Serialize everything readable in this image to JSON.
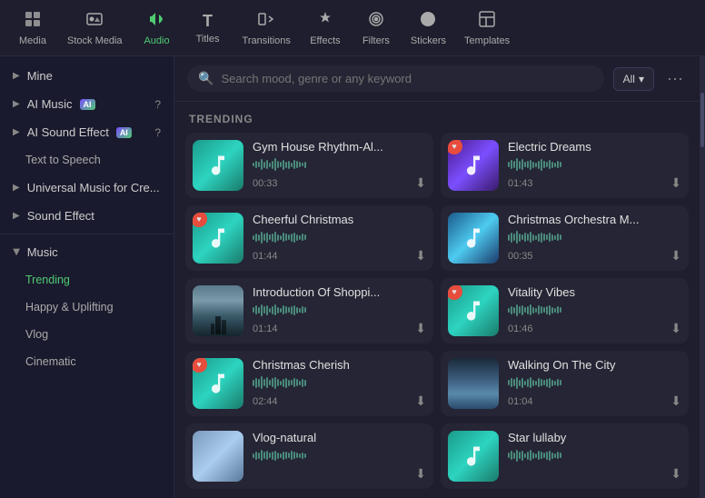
{
  "nav": {
    "items": [
      {
        "id": "media",
        "label": "Media",
        "icon": "⬜",
        "active": false
      },
      {
        "id": "stock-media",
        "label": "Stock Media",
        "icon": "📷",
        "active": false
      },
      {
        "id": "audio",
        "label": "Audio",
        "icon": "♪",
        "active": true
      },
      {
        "id": "titles",
        "label": "Titles",
        "icon": "T",
        "active": false
      },
      {
        "id": "transitions",
        "label": "Transitions",
        "icon": "▷",
        "active": false
      },
      {
        "id": "effects",
        "label": "Effects",
        "icon": "✦",
        "active": false
      },
      {
        "id": "filters",
        "label": "Filters",
        "icon": "◎",
        "active": false
      },
      {
        "id": "stickers",
        "label": "Stickers",
        "icon": "✿",
        "active": false
      },
      {
        "id": "templates",
        "label": "Templates",
        "icon": "⊟",
        "active": false
      }
    ]
  },
  "sidebar": {
    "items": [
      {
        "id": "mine",
        "label": "Mine",
        "type": "parent",
        "expanded": false
      },
      {
        "id": "ai-music",
        "label": "AI Music",
        "type": "parent",
        "badge": "AI",
        "has_help": true,
        "expanded": false
      },
      {
        "id": "ai-sound-effect",
        "label": "AI Sound Effect",
        "type": "parent",
        "badge": "AI",
        "has_help": true,
        "expanded": false
      },
      {
        "id": "text-to-speech",
        "label": "Text to Speech",
        "type": "child",
        "active": false
      },
      {
        "id": "universal-music",
        "label": "Universal Music for Cre...",
        "type": "parent",
        "expanded": false
      },
      {
        "id": "sound-effect",
        "label": "Sound Effect",
        "type": "parent",
        "expanded": false
      },
      {
        "id": "music",
        "label": "Music",
        "type": "parent",
        "expanded": true
      },
      {
        "id": "trending",
        "label": "Trending",
        "type": "sub",
        "active": true
      },
      {
        "id": "happy-uplifting",
        "label": "Happy & Uplifting",
        "type": "sub",
        "active": false
      },
      {
        "id": "vlog",
        "label": "Vlog",
        "type": "sub",
        "active": false
      },
      {
        "id": "cinematic",
        "label": "Cinematic",
        "type": "sub",
        "active": false
      }
    ]
  },
  "search": {
    "placeholder": "Search mood, genre or any keyword",
    "filter_label": "All"
  },
  "trending": {
    "header": "TRENDING",
    "tracks": [
      {
        "id": "gym-house",
        "title": "Gym House Rhythm-Al...",
        "duration": "00:33",
        "thumb_type": "teal",
        "has_heart": false
      },
      {
        "id": "electric-dreams",
        "title": "Electric Dreams",
        "duration": "01:43",
        "thumb_type": "purple",
        "has_heart": true
      },
      {
        "id": "cheerful-christmas",
        "title": "Cheerful Christmas",
        "duration": "01:44",
        "thumb_type": "teal",
        "has_heart": true
      },
      {
        "id": "christmas-orchestra",
        "title": "Christmas Orchestra M...",
        "duration": "00:35",
        "thumb_type": "sky",
        "has_heart": false
      },
      {
        "id": "introduction-shopping",
        "title": "Introduction Of Shoppi...",
        "duration": "01:14",
        "thumb_type": "photo-shopping",
        "has_heart": false
      },
      {
        "id": "vitality-vibes",
        "title": "Vitality Vibes",
        "duration": "01:46",
        "thumb_type": "teal",
        "has_heart": true
      },
      {
        "id": "christmas-cherish",
        "title": "Christmas Cherish",
        "duration": "02:44",
        "thumb_type": "teal",
        "has_heart": true
      },
      {
        "id": "walking-on-city",
        "title": "Walking On The City",
        "duration": "01:04",
        "thumb_type": "photo-walking",
        "has_heart": false
      },
      {
        "id": "vlog-natural",
        "title": "Vlog-natural",
        "duration": "",
        "thumb_type": "photo-vlog",
        "has_heart": false
      },
      {
        "id": "star-lullaby",
        "title": "Star lullaby",
        "duration": "",
        "thumb_type": "photo-star",
        "has_heart": false
      }
    ]
  }
}
